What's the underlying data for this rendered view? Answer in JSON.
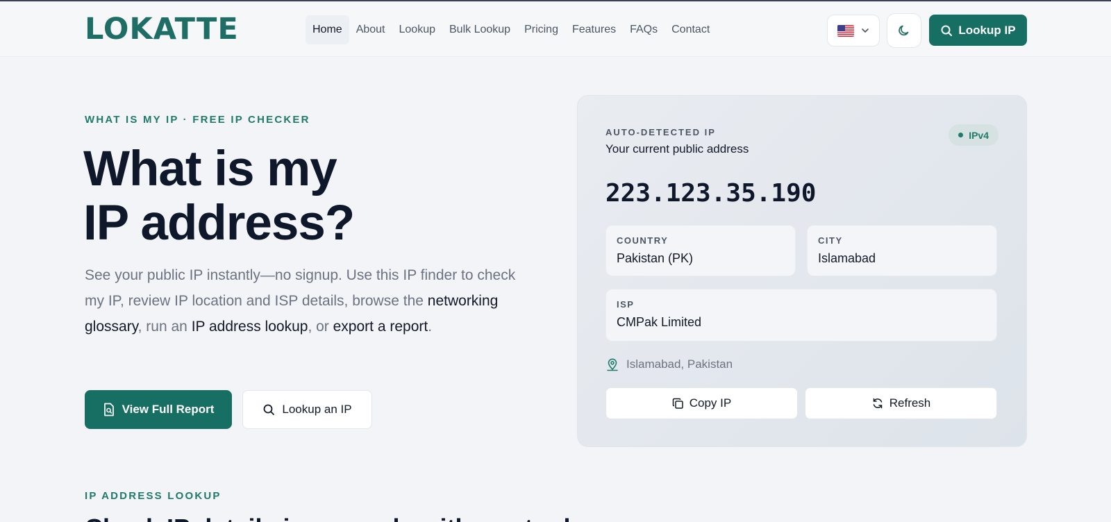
{
  "brand": {
    "logo_text": "LOKATTE"
  },
  "nav": {
    "items": [
      {
        "label": "Home",
        "active": true
      },
      {
        "label": "About"
      },
      {
        "label": "Lookup"
      },
      {
        "label": "Bulk Lookup"
      },
      {
        "label": "Pricing"
      },
      {
        "label": "Features"
      },
      {
        "label": "FAQs"
      },
      {
        "label": "Contact"
      }
    ]
  },
  "header_actions": {
    "language_flag": "us-flag-icon",
    "theme_icon": "moon-icon",
    "lookup_button": "Lookup IP"
  },
  "hero": {
    "eyebrow": "WHAT IS MY IP · FREE IP CHECKER",
    "title_line1": "What is my",
    "title_line2": "IP address?",
    "desc_part1": "See your public IP instantly—no signup. Use this IP finder to check my IP, review IP location and ISP details, browse the ",
    "link_glossary": "networking glossary",
    "desc_part2": ", run an ",
    "link_lookup": "IP address lookup",
    "desc_part3": ", or ",
    "link_export": "export a report",
    "desc_part4": ".",
    "primary_button": "View Full Report",
    "secondary_button": "Lookup an IP"
  },
  "ip_card": {
    "eyebrow": "AUTO-DETECTED IP",
    "subtitle": "Your current public address",
    "badge": "IPv4",
    "ip": "223.123.35.190",
    "country_label": "COUNTRY",
    "country_value": "Pakistan (PK)",
    "city_label": "CITY",
    "city_value": "Islamabad",
    "isp_label": "ISP",
    "isp_value": "CMPak Limited",
    "location": "Islamabad, Pakistan",
    "copy_button": "Copy IP",
    "refresh_button": "Refresh"
  },
  "next_section": {
    "eyebrow": "IP ADDRESS LOOKUP",
    "heading": "Check IP details in seconds with our tool"
  },
  "colors": {
    "accent": "#176e63",
    "accent_text": "#1f7a6a",
    "page_bg": "#f2f4f7"
  }
}
